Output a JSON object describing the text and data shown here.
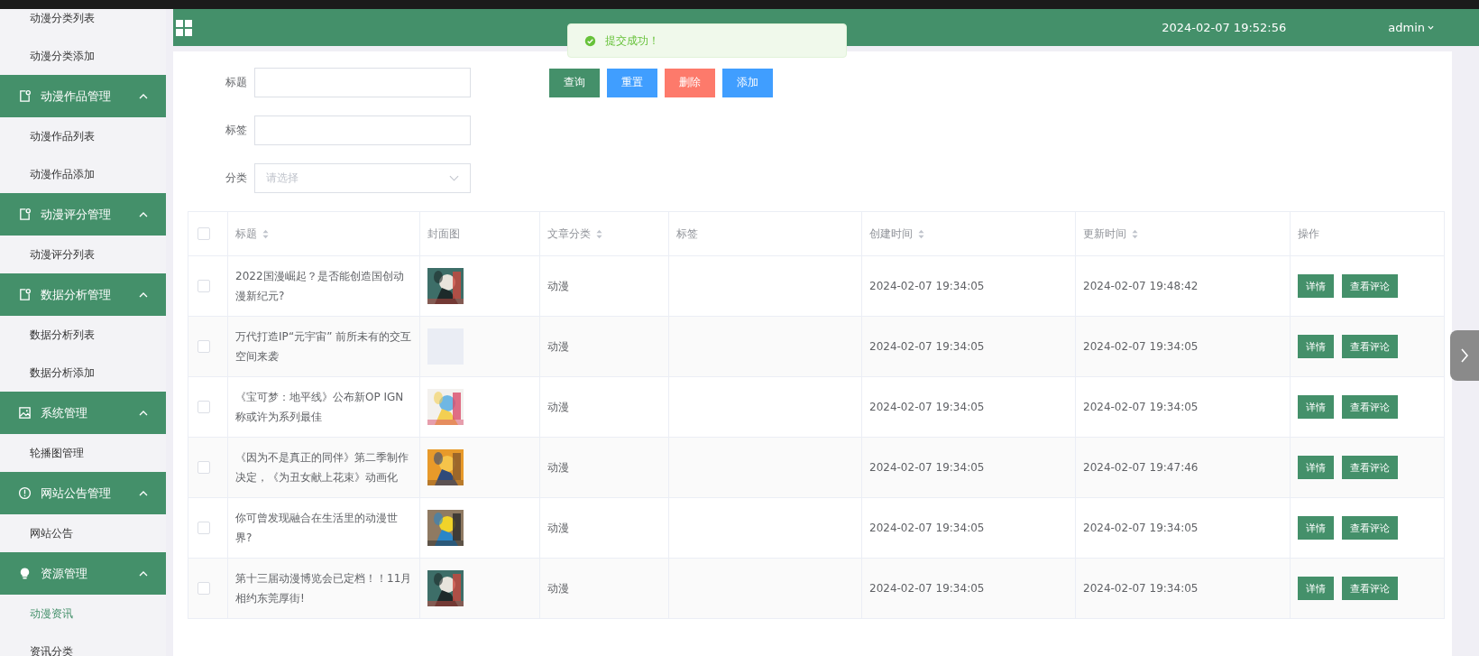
{
  "sidebar": {
    "items": [
      {
        "kind": "link",
        "label": "动漫分类列表",
        "selected": false
      },
      {
        "kind": "link",
        "label": "动漫分类添加",
        "selected": false
      },
      {
        "kind": "group",
        "label": "动漫作品管理",
        "expanded": true
      },
      {
        "kind": "link",
        "label": "动漫作品列表",
        "selected": false
      },
      {
        "kind": "link",
        "label": "动漫作品添加",
        "selected": false
      },
      {
        "kind": "group",
        "label": "动漫评分管理",
        "expanded": true
      },
      {
        "kind": "link",
        "label": "动漫评分列表",
        "selected": false
      },
      {
        "kind": "group",
        "label": "数据分析管理",
        "expanded": true
      },
      {
        "kind": "link",
        "label": "数据分析列表",
        "selected": false
      },
      {
        "kind": "link",
        "label": "数据分析添加",
        "selected": false
      },
      {
        "kind": "group",
        "label": "系统管理",
        "expanded": true
      },
      {
        "kind": "link",
        "label": "轮播图管理",
        "selected": false
      },
      {
        "kind": "group",
        "label": "网站公告管理",
        "expanded": true
      },
      {
        "kind": "link",
        "label": "网站公告",
        "selected": false
      },
      {
        "kind": "group",
        "label": "资源管理",
        "expanded": true
      },
      {
        "kind": "link",
        "label": "动漫资讯",
        "selected": true
      },
      {
        "kind": "link",
        "label": "资讯分类",
        "selected": false
      }
    ]
  },
  "header": {
    "datetime": "2024-02-07 19:52:56",
    "user": "admin"
  },
  "toast": {
    "message": "提交成功！"
  },
  "filters": [
    {
      "label": "标题",
      "kind": "text"
    },
    {
      "label": "标签",
      "kind": "text"
    },
    {
      "label": "分类",
      "kind": "select",
      "placeholder": "请选择"
    }
  ],
  "buttons": [
    {
      "label": "查询",
      "kind": "primary"
    },
    {
      "label": "重置",
      "kind": "info"
    },
    {
      "label": "删除",
      "kind": "danger"
    },
    {
      "label": "添加",
      "kind": "info"
    }
  ],
  "table": {
    "select_all": {
      "checked": false
    },
    "columns": [
      {
        "label": "标题",
        "sortable": true
      },
      {
        "label": "封面图",
        "sortable": false
      },
      {
        "label": "文章分类",
        "sortable": true
      },
      {
        "label": "标签",
        "sortable": false
      },
      {
        "label": "创建时间",
        "sortable": true
      },
      {
        "label": "更新时间",
        "sortable": true
      },
      {
        "label": "操作",
        "sortable": false
      }
    ],
    "rows": [
      {
        "checked": false,
        "title": "2022国漫崛起？是否能创造国创动漫新纪元?",
        "cover": {
          "kind": "picture"
        },
        "category": "动漫",
        "created": "2024-02-07 19:34:05",
        "updated": "2024-02-07 19:48:42",
        "actions": [
          "详情",
          "查看评论"
        ]
      },
      {
        "checked": false,
        "title": "万代打造IP“元宇宙” 前所未有的交互空间来袭",
        "cover": {
          "kind": "empty"
        },
        "category": "动漫",
        "created": "2024-02-07 19:34:05",
        "updated": "2024-02-07 19:34:05",
        "actions": [
          "详情",
          "查看评论"
        ]
      },
      {
        "checked": false,
        "title": "《宝可梦：地平线》公布新OP IGN称或许为系列最佳",
        "cover": {
          "kind": "picture"
        },
        "category": "动漫",
        "created": "2024-02-07 19:34:05",
        "updated": "2024-02-07 19:34:05",
        "actions": [
          "详情",
          "查看评论"
        ]
      },
      {
        "checked": false,
        "title": "《因为不是真正的同伴》第二季制作决定，《为丑女献上花束》动画化",
        "cover": {
          "kind": "picture"
        },
        "category": "动漫",
        "created": "2024-02-07 19:34:05",
        "updated": "2024-02-07 19:47:46",
        "actions": [
          "详情",
          "查看评论"
        ]
      },
      {
        "checked": false,
        "title": "你可曾发现融合在生活里的动漫世界?",
        "cover": {
          "kind": "picture"
        },
        "category": "动漫",
        "created": "2024-02-07 19:34:05",
        "updated": "2024-02-07 19:34:05",
        "actions": [
          "详情",
          "查看评论"
        ]
      },
      {
        "checked": false,
        "title": "第十三届动漫博览会已定档！！11月相约东莞厚街!",
        "cover": {
          "kind": "picture"
        },
        "category": "动漫",
        "created": "2024-02-07 19:34:05",
        "updated": "2024-02-07 19:34:05",
        "actions": [
          "详情",
          "查看评论"
        ]
      }
    ]
  }
}
